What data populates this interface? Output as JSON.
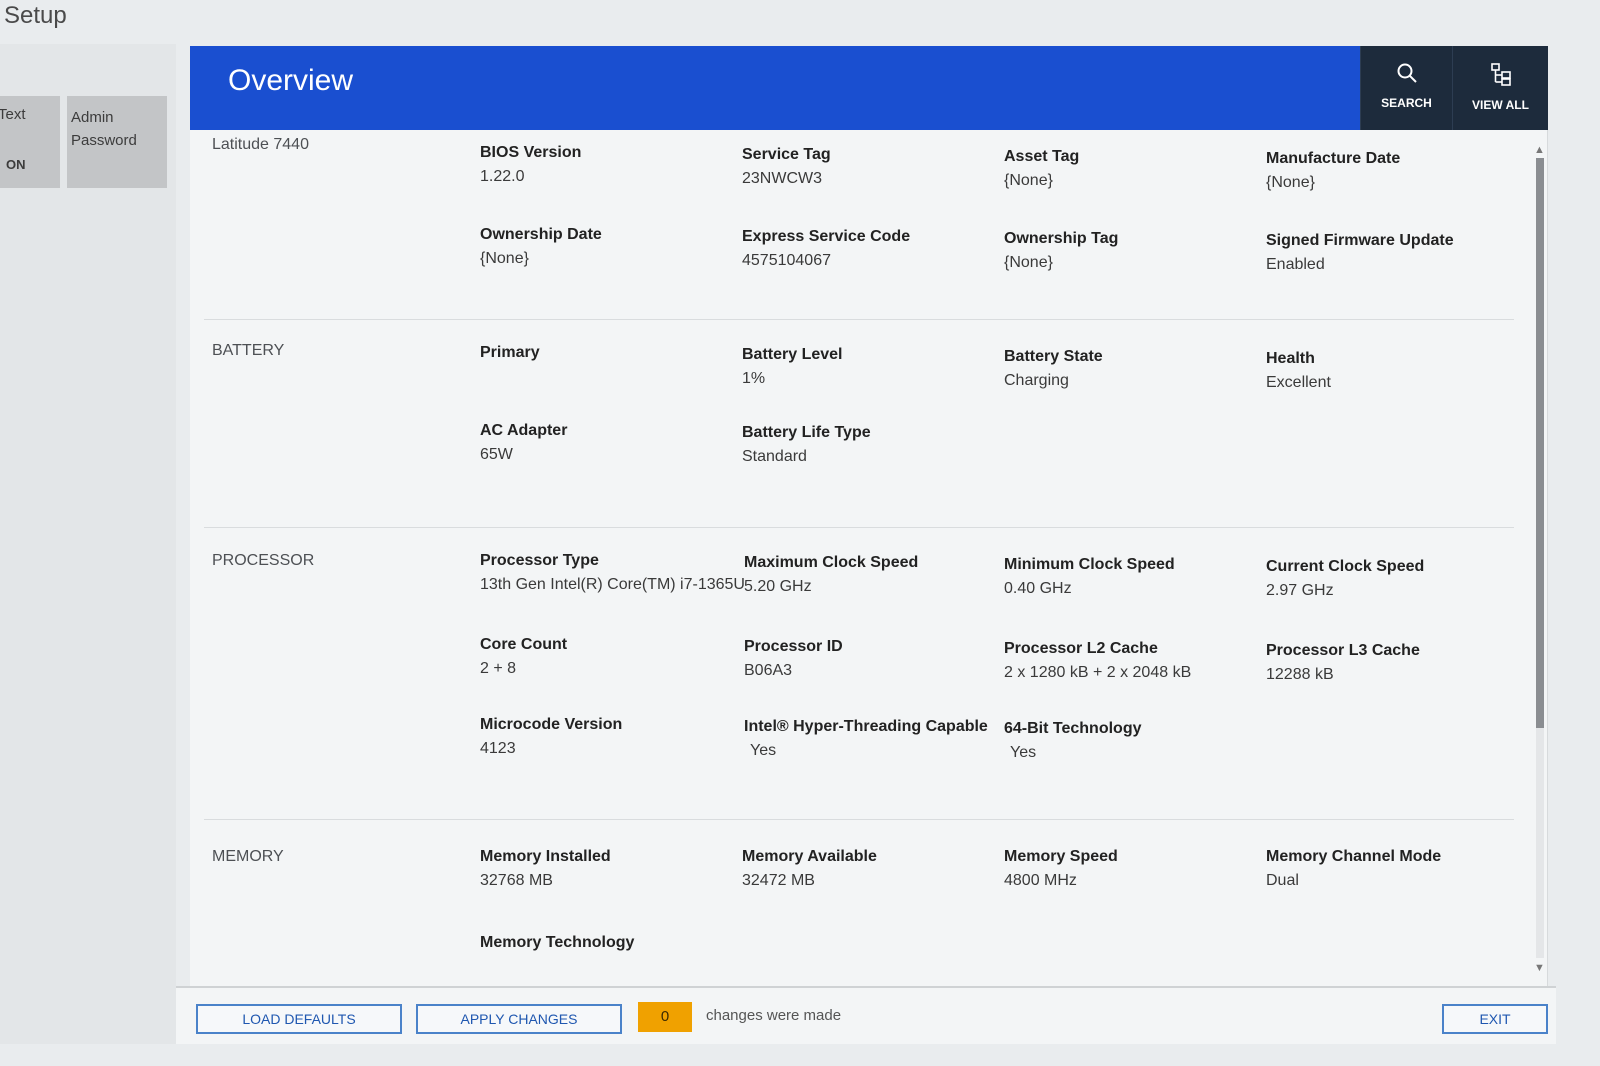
{
  "app": {
    "title": "Setup"
  },
  "left_panel": {
    "tiles": [
      {
        "label": "Text",
        "state": "ON"
      },
      {
        "label": "Admin Password"
      }
    ]
  },
  "header": {
    "title": "Overview",
    "search_label": "SEARCH",
    "view_all_label": "VIEW ALL",
    "search_icon": "search-icon",
    "view_all_icon": "tree-view-icon"
  },
  "sections": {
    "system": {
      "label": "Latitude 7440",
      "fields": [
        {
          "label": "BIOS Version",
          "value": "1.22.0"
        },
        {
          "label": "Service Tag",
          "value": "23NWCW3"
        },
        {
          "label": "Asset Tag",
          "value": "{None}"
        },
        {
          "label": "Manufacture Date",
          "value": "{None}"
        },
        {
          "label": "Ownership Date",
          "value": "{None}"
        },
        {
          "label": "Express Service Code",
          "value": "4575104067"
        },
        {
          "label": "Ownership Tag",
          "value": "{None}"
        },
        {
          "label": "Signed Firmware Update",
          "value": "Enabled"
        }
      ]
    },
    "battery": {
      "label": "BATTERY",
      "fields": [
        {
          "label": "Primary",
          "value": ""
        },
        {
          "label": "Battery Level",
          "value": "1%"
        },
        {
          "label": "Battery State",
          "value": "Charging"
        },
        {
          "label": "Health",
          "value": "Excellent"
        },
        {
          "label": "AC Adapter",
          "value": "65W"
        },
        {
          "label": "Battery Life Type",
          "value": "Standard"
        }
      ]
    },
    "processor": {
      "label": "PROCESSOR",
      "fields": [
        {
          "label": "Processor Type",
          "value": "13th Gen Intel(R) Core(TM) i7-1365U"
        },
        {
          "label": "Maximum Clock Speed",
          "value": "5.20 GHz"
        },
        {
          "label": "Minimum Clock Speed",
          "value": "0.40 GHz"
        },
        {
          "label": "Current Clock Speed",
          "value": "2.97 GHz"
        },
        {
          "label": "Core Count",
          "value": "2 + 8"
        },
        {
          "label": "Processor ID",
          "value": "B06A3"
        },
        {
          "label": "Processor L2 Cache",
          "value": "2 x 1280 kB + 2 x 2048 kB"
        },
        {
          "label": "Processor L3 Cache",
          "value": "12288 kB"
        },
        {
          "label": "Microcode Version",
          "value": "4123"
        },
        {
          "label": "Intel® Hyper-Threading Capable",
          "value": "Yes"
        },
        {
          "label": "64-Bit Technology",
          "value": "Yes"
        }
      ]
    },
    "memory": {
      "label": "MEMORY",
      "fields": [
        {
          "label": "Memory Installed",
          "value": "32768 MB"
        },
        {
          "label": "Memory Available",
          "value": "32472 MB"
        },
        {
          "label": "Memory Speed",
          "value": "4800 MHz"
        },
        {
          "label": "Memory Channel Mode",
          "value": "Dual"
        },
        {
          "label": "Memory Technology",
          "value": ""
        }
      ]
    }
  },
  "footer": {
    "load_defaults": "LOAD DEFAULTS",
    "apply_changes": "APPLY CHANGES",
    "changes_count": "0",
    "changes_text": "changes were made",
    "exit": "EXIT"
  },
  "colors": {
    "header_blue": "#1a4fd0",
    "header_button_dark": "#1d2b3c",
    "changes_badge": "#f0a100",
    "button_border": "#4a82c9"
  }
}
